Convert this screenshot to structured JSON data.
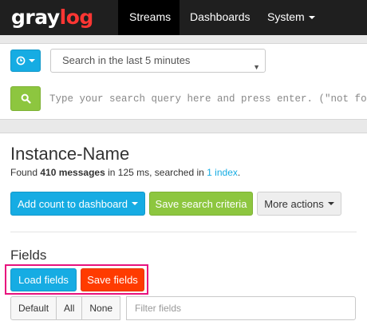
{
  "colors": {
    "navbar": "#1f1f1f",
    "accent_blue": "#16ace3",
    "accent_green": "#8dc63f",
    "accent_orange": "#ff3b00",
    "highlight": "#e8127d",
    "logo_red": "#ff3633"
  },
  "navbar": {
    "logo_part1": "gray",
    "logo_part2": "log",
    "items": [
      {
        "label": "Streams",
        "active": true
      },
      {
        "label": "Dashboards"
      },
      {
        "label": "System"
      }
    ]
  },
  "search": {
    "timerange_icon": "clock-icon",
    "timerange_value": "Search in the last 5 minutes",
    "search_icon": "magnifier-icon",
    "query_placeholder": "Type your search query here and press enter. (\"not found\""
  },
  "results": {
    "title": "Instance-Name",
    "found_prefix": "Found ",
    "message_count": "410 messages",
    "found_middle": " in 125 ms, searched in ",
    "index_link": "1 index",
    "found_suffix": ".",
    "actions": {
      "add_count": "Add count to dashboard",
      "save_search": "Save search criteria",
      "more_actions": "More actions"
    }
  },
  "fields": {
    "title": "Fields",
    "load_button": "Load fields",
    "save_button": "Save fields",
    "filter_buttons": [
      "Default",
      "All",
      "None"
    ],
    "filter_placeholder": "Filter fields"
  }
}
